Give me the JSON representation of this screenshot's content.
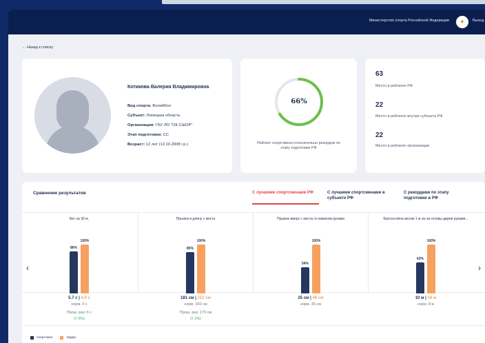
{
  "header": {
    "ministry": "Министерство спорта Российской Федерации",
    "logout": "Выход",
    "emblem_icon": "eagle-emblem-icon"
  },
  "nav": {
    "back": "← Назад к списку"
  },
  "profile": {
    "name": "Котикова Валерия Владимировна",
    "fields": [
      {
        "label": "Вид спорта:",
        "value": "Волейбол"
      },
      {
        "label": "Субъект:",
        "value": "Липецкая область"
      },
      {
        "label": "Организация:",
        "value": "ГБУ ЛО \"ОК СШОР\""
      },
      {
        "label": "Этап подготовки:",
        "value": "СС"
      },
      {
        "label": "Возраст:",
        "value": "12 лет (13.10.2008 г.р.)"
      }
    ]
  },
  "rating": {
    "percent_label": "66%",
    "percent_value": 66,
    "description": "Рейтинг спортсмена относительно рекордов по этапу подготовки РФ",
    "ring_color": "#6cc04a"
  },
  "places": [
    {
      "value": "63",
      "label": "Место в рейтинге РФ"
    },
    {
      "value": "22",
      "label": "Место в рейтинге внутри субъекта РФ"
    },
    {
      "value": "22",
      "label": "Место в рейтинге организации"
    }
  ],
  "compare": {
    "title": "Сравнение результатов",
    "tabs": [
      {
        "label": "С лучшими спортсменами РФ",
        "active": true
      },
      {
        "label": "С лучшими спортсменами в субъекте РФ",
        "active": false
      },
      {
        "label": "С рекордами по этапу подготовки в РФ",
        "active": false
      }
    ],
    "prev_arrow": "‹",
    "next_arrow": "›",
    "panels": [
      {
        "title": "Бег на 30 м.",
        "athlete_pct": 86,
        "athlete_label": "86%",
        "leader_pct": 100,
        "leader_label": "100%",
        "athlete_result": "5.7 с",
        "leader_result": "4.9 с",
        "norm": "норм. 6 с",
        "prev": "Прош. раз: 6 с",
        "delta": "(⭡ 5%)"
      },
      {
        "title": "Прыжок в длину с места",
        "athlete_pct": 85,
        "athlete_label": "85%",
        "leader_pct": 100,
        "leader_label": "100%",
        "athlete_result": "181 см",
        "leader_result": "212 см",
        "norm": "норм. 160 см",
        "prev": "Прош. раз: 179 см",
        "delta": "(⭡ 1%)"
      },
      {
        "title": "Прыжок вверх с места со взмахом руками",
        "athlete_pct": 54,
        "athlete_label": "54%",
        "leader_pct": 100,
        "leader_label": "100%",
        "athlete_result": "25 см",
        "leader_result": "46 см",
        "norm": "норм. 35 см",
        "prev": "",
        "delta": ""
      },
      {
        "title": "Бросок мяча весом 1 кг из-за головы двумя руками...",
        "athlete_pct": 63,
        "athlete_label": "63%",
        "leader_pct": 100,
        "leader_label": "100%",
        "athlete_result": "10 м",
        "leader_result": "16 м",
        "norm": "норм. 8 м",
        "prev": "",
        "delta": ""
      }
    ],
    "legend": [
      {
        "label": "спортсмен",
        "color": "#26375f"
      },
      {
        "label": "лидер",
        "color": "#f7a160"
      }
    ]
  }
}
